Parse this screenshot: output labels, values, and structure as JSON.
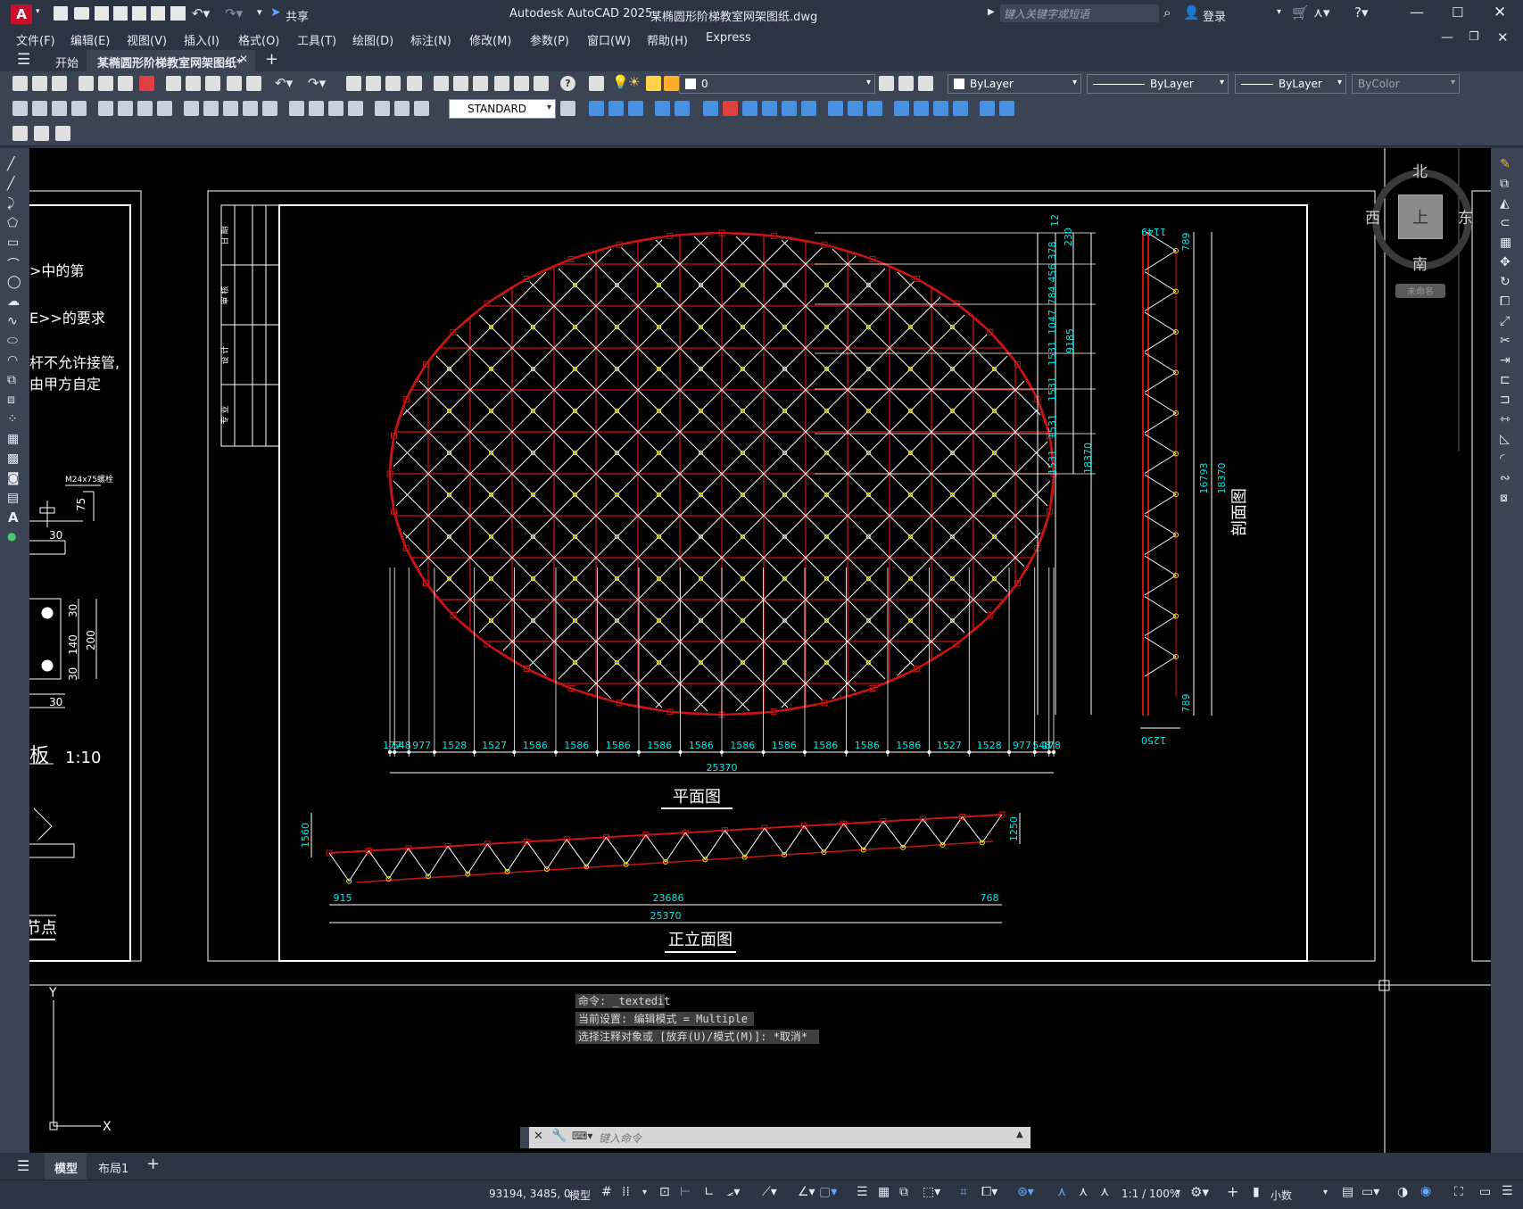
{
  "app": {
    "title": "Autodesk AutoCAD 2025",
    "filename": "某椭圆形阶梯教室网架图纸.dwg",
    "share_label": "共享",
    "search_placeholder": "键入关键字或短语",
    "login_label": "登录"
  },
  "menu": [
    "文件(F)",
    "编辑(E)",
    "视图(V)",
    "插入(I)",
    "格式(O)",
    "工具(T)",
    "绘图(D)",
    "标注(N)",
    "修改(M)",
    "参数(P)",
    "窗口(W)",
    "帮助(H)",
    "Express"
  ],
  "tabs": {
    "start": "开始",
    "active": "某椭圆形阶梯教室网架图纸*",
    "add": "+"
  },
  "toolbar": {
    "layer_value": "0",
    "textstyle": "STANDARD",
    "color": "ByLayer",
    "linetype": "ByLayer",
    "lineweight": "ByLayer",
    "plotstyle": "ByColor"
  },
  "viewcube": {
    "north": "北",
    "south": "南",
    "east": "东",
    "west": "西",
    "face": "上",
    "wcs": "未命名"
  },
  "drawing": {
    "left_notes": [
      ">中的第",
      "E>>的要求",
      "杆不允许接管,",
      "由甲方自定"
    ],
    "bolt_label": "M24x75螺栓",
    "dim_75": "75",
    "dim_30a": "30",
    "dim_30b": "30",
    "dim_140": "140",
    "dim_200": "200",
    "dim_30c": "30",
    "dim_30d": "30",
    "plate_label": "板",
    "plate_scale": "1:10",
    "node_label": "节点",
    "titleblock": [
      "日 期",
      "审 核",
      "设 计",
      "专 业"
    ],
    "plan_title": "平面图",
    "elev_title": "正立面图",
    "section_title": "剖面图",
    "plan_dims_bottom": [
      "177",
      "548",
      "977",
      "1528",
      "1527",
      "1586",
      "1586",
      "1586",
      "1586",
      "1586",
      "1586",
      "1586",
      "1586",
      "1586",
      "1586",
      "1527",
      "1528",
      "977",
      "548",
      "178"
    ],
    "plan_total": "25370",
    "plan_dims_right": [
      "378",
      "456",
      "784",
      "1047",
      "1531",
      "1531",
      "1531",
      "1531"
    ],
    "plan_dim_230": "230",
    "plan_dim_12": "12",
    "plan_dim_9185": "9185",
    "plan_dim_18370": "18370",
    "section_dims": [
      "1149",
      "789",
      "16793",
      "18370",
      "789",
      "1250"
    ],
    "elev_dims": [
      "1560",
      "1250",
      "915",
      "23686",
      "768",
      "25370"
    ]
  },
  "command": {
    "history": [
      "命令: _textedit",
      "当前设置: 编辑模式 = Multiple",
      "选择注释对象或 [放弃(U)/模式(M)]: *取消*"
    ],
    "placeholder": "键入命令"
  },
  "model_tabs": [
    "模型",
    "布局1"
  ],
  "status": {
    "coords": "93194, 3485, 0",
    "model": "模型",
    "scale": "1:1 / 100%",
    "units": "小数"
  },
  "colors": {
    "canvas_bg": "#000000",
    "grid_red": "#c81414",
    "grid_white": "#ffffff",
    "dim_cyan": "#00e6e6",
    "node_yellow": "#e6e600"
  }
}
